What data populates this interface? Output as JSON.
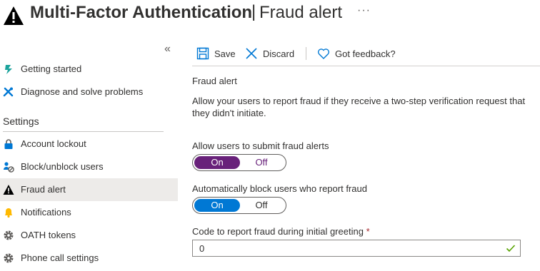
{
  "header": {
    "title": "Multi-Factor Authentication",
    "separator": "|",
    "subtitle": "Fraud alert",
    "more": "···"
  },
  "sidebar": {
    "collapse": "«",
    "items": [
      {
        "label": "Getting started",
        "icon": "rocket-icon"
      },
      {
        "label": "Diagnose and solve problems",
        "icon": "wrench-icon"
      }
    ],
    "section_title": "Settings",
    "settings_items": [
      {
        "label": "Account lockout",
        "icon": "lock-icon"
      },
      {
        "label": "Block/unblock users",
        "icon": "users-block-icon"
      },
      {
        "label": "Fraud alert",
        "icon": "warning-icon",
        "active": true
      },
      {
        "label": "Notifications",
        "icon": "bell-icon"
      },
      {
        "label": "OATH tokens",
        "icon": "gear-icon"
      },
      {
        "label": "Phone call settings",
        "icon": "gear-icon"
      }
    ]
  },
  "toolbar": {
    "save": "Save",
    "discard": "Discard",
    "feedback": "Got feedback?"
  },
  "content": {
    "heading": "Fraud alert",
    "description": "Allow your users to report fraud if they receive a two-step verification request that they didn't initiate.",
    "allow_label": "Allow users to submit fraud alerts",
    "allow_toggle": {
      "on": "On",
      "off": "Off",
      "selected": "On"
    },
    "autoblock_label": "Automatically block users who report fraud",
    "autoblock_toggle": {
      "on": "On",
      "off": "Off",
      "selected": "On"
    },
    "code_label": "Code to report fraud during initial greeting",
    "code_required": "*",
    "code_value": "0"
  },
  "colors": {
    "toggle_purple": "#68217a",
    "toggle_blue": "#0078d4",
    "accent": "#0078d4",
    "valid_check": "#57a300"
  }
}
